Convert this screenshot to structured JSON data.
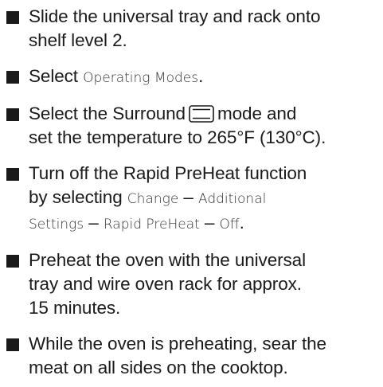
{
  "steps": [
    {
      "line1": "Slide the universal tray and rack onto",
      "line2": "shelf level 2."
    },
    {
      "text_before": "Select ",
      "ui_label": "Operating Modes",
      "text_after": "."
    },
    {
      "text_before": "Select the Surround",
      "icon": "surround-mode-icon",
      "text_after": "mode and",
      "line2": "set the temperature to 265°F (130°C)."
    },
    {
      "line1": "Turn off the Rapid PreHeat function",
      "line2_before": "by selecting ",
      "ui_change": "Change",
      "dash1": " – ",
      "ui_additional": "Additional",
      "ui_settings": "Settings",
      "dash2": " – ",
      "ui_rapid": "Rapid PreHeat",
      "dash3": " – ",
      "ui_off": "Off",
      "end": "."
    },
    {
      "line1": "Preheat the oven with the universal",
      "line2": "tray and wire oven rack for approx.",
      "line3": "15 minutes."
    },
    {
      "line1": "While the oven is preheating, sear the",
      "line2": "meat on all sides on the cooktop."
    }
  ]
}
